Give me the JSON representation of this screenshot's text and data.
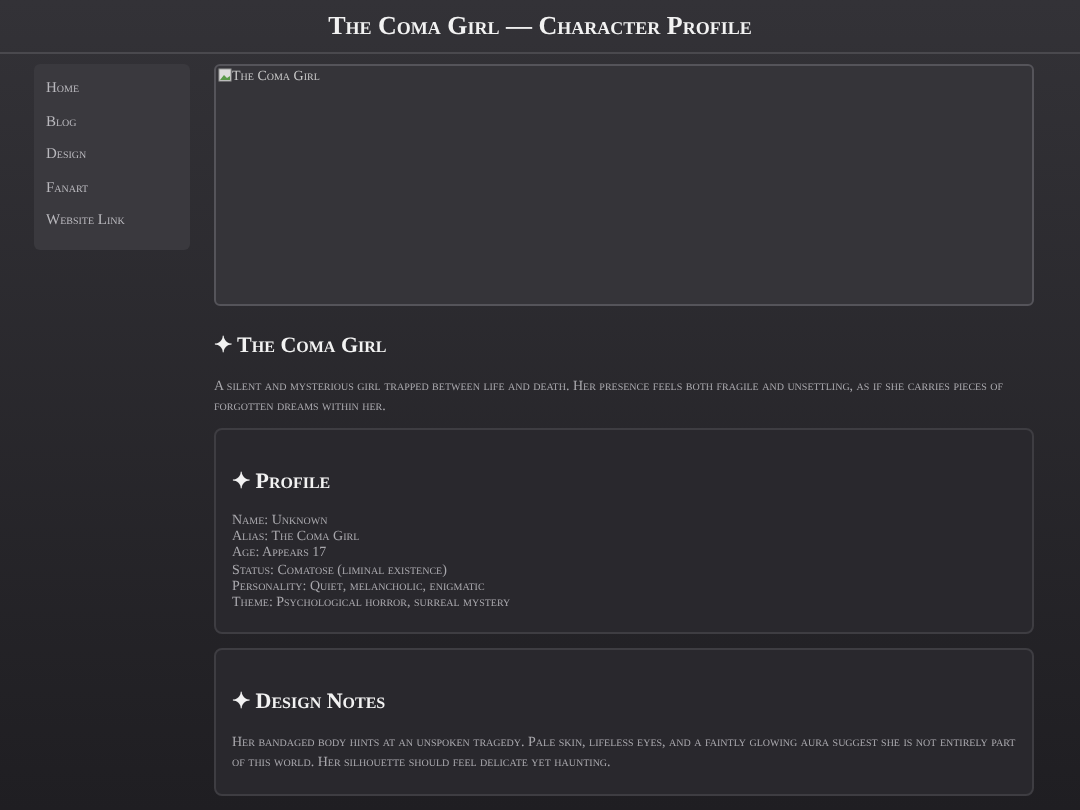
{
  "header": {
    "title": "The Coma Girl — Character Profile"
  },
  "nav": [
    "Home",
    "Blog",
    "Design",
    "Fanart",
    "Website Link"
  ],
  "image": {
    "alt": "The Coma Girl"
  },
  "intro": {
    "title": "✦ The Coma Girl",
    "text": "A silent and mysterious girl trapped between life and death. Her presence feels both fragile and unsettling, as if she carries pieces of forgotten dreams within her."
  },
  "sections": [
    {
      "kind": "list",
      "title": "✦ Profile",
      "lines": [
        "Name: Unknown",
        "Alias: The Coma Girl",
        "Age: Appears 17",
        "Status: Comatose (liminal existence)",
        "Personality: Quiet, melancholic, enigmatic",
        "Theme: Psychological horror, surreal mystery"
      ]
    },
    {
      "kind": "text",
      "title": "✦ Design Notes",
      "text": "Her bandaged body hints at an unspoken tragedy. Pale skin, lifeless eyes, and a faintly glowing aura suggest she is not entirely part of this world. Her silhouette should feel delicate yet haunting."
    }
  ]
}
